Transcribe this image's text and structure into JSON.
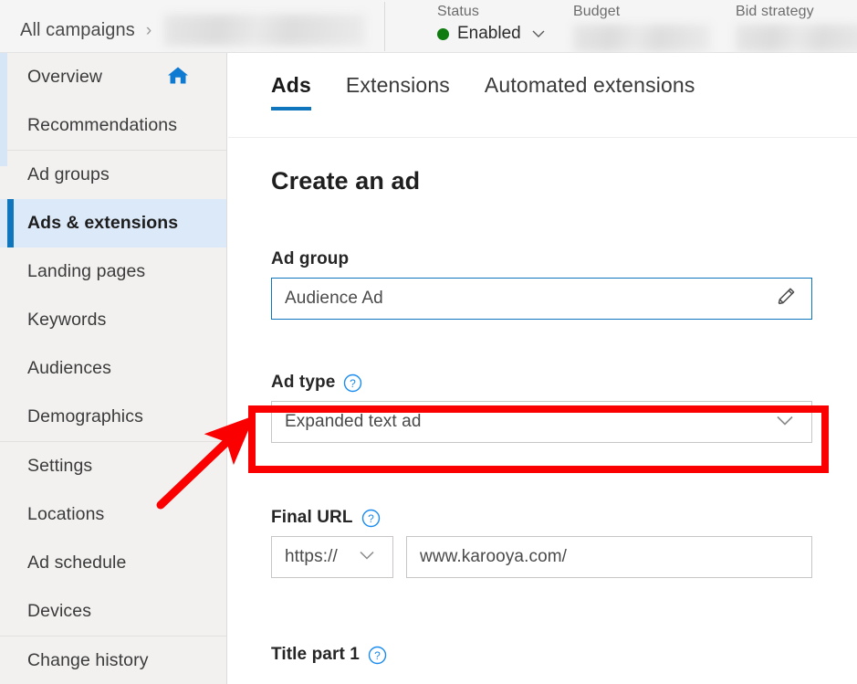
{
  "topbar": {
    "breadcrumb": {
      "root_label": "All campaigns",
      "separator": "›",
      "campaign_name_redacted": ""
    },
    "stats": [
      {
        "label": "Status",
        "value": "Enabled",
        "dot_color": "#107c10",
        "has_dropdown": true,
        "redacted": false
      },
      {
        "label": "Budget",
        "value": "",
        "redacted": true
      },
      {
        "label": "Bid strategy",
        "value": "",
        "redacted": true
      }
    ]
  },
  "sidebar": {
    "groups": [
      {
        "items": [
          {
            "label": "Overview",
            "icon": "home-icon",
            "selected": false
          },
          {
            "label": "Recommendations",
            "icon": null,
            "selected": false
          }
        ]
      },
      {
        "items": [
          {
            "label": "Ad groups",
            "icon": null,
            "selected": false
          },
          {
            "label": "Ads & extensions",
            "icon": null,
            "selected": true
          },
          {
            "label": "Landing pages",
            "icon": null,
            "selected": false
          },
          {
            "label": "Keywords",
            "icon": null,
            "selected": false
          },
          {
            "label": "Audiences",
            "icon": null,
            "selected": false
          },
          {
            "label": "Demographics",
            "icon": null,
            "selected": false
          }
        ]
      },
      {
        "items": [
          {
            "label": "Settings",
            "icon": null,
            "selected": false
          },
          {
            "label": "Locations",
            "icon": null,
            "selected": false
          },
          {
            "label": "Ad schedule",
            "icon": null,
            "selected": false
          },
          {
            "label": "Devices",
            "icon": null,
            "selected": false
          }
        ]
      },
      {
        "items": [
          {
            "label": "Change history",
            "icon": null,
            "selected": false
          }
        ]
      }
    ]
  },
  "main": {
    "tabs": [
      {
        "label": "Ads",
        "active": true
      },
      {
        "label": "Extensions",
        "active": false
      },
      {
        "label": "Automated extensions",
        "active": false
      }
    ],
    "page_title": "Create an ad",
    "fields": {
      "ad_group": {
        "label": "Ad group",
        "value": "Audience Ad",
        "icon": "pencil-icon",
        "focused": true
      },
      "ad_type": {
        "label": "Ad type",
        "help": "?",
        "value": "Expanded text ad",
        "icon": "chevron-down-icon",
        "highlighted": true
      },
      "final_url": {
        "label": "Final URL",
        "help": "?",
        "protocol": "https://",
        "protocol_icon": "chevron-down-icon",
        "url": "www.karooya.com/"
      },
      "title_part_1": {
        "label": "Title part 1",
        "help": "?"
      }
    }
  },
  "annotations": {
    "highlight_color": "#fb0000",
    "accent_color": "#0f75bc",
    "selected_bg": "#dbe9f8",
    "arrow": {
      "description": "red-arrow-pointing-to-ad-type-dropdown"
    }
  }
}
